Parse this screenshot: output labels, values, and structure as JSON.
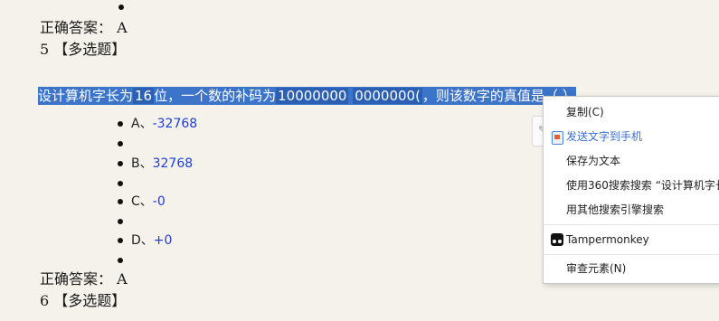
{
  "content": {
    "answer_label_1": "正确答案：  A",
    "q5_header": "5  【多选题】",
    "question": {
      "part1": "设计算机字长为",
      "word_size": "16",
      "part2": "位，一个数的补码为",
      "code1": "10000000",
      "code2": "0000000(",
      "part3": "，则该数字的真值是（   ）"
    },
    "options": [
      {
        "letter": "A、",
        "value": "-32768"
      },
      {
        "letter": "B、",
        "value": "32768"
      },
      {
        "letter": "C、",
        "value": "-0"
      },
      {
        "letter": "D、",
        "value": "+0"
      }
    ],
    "answer_label_2": "正确答案：  A",
    "q6_header": "6  【多选题】"
  },
  "context_menu": {
    "items": [
      {
        "label": "复制(C)"
      },
      {
        "label": "发送文字到手机",
        "color": "#3d6fd0",
        "icon": "send-to-phone-icon"
      },
      {
        "label": "保存为文本"
      },
      {
        "label": "使用360搜索搜索 “设计算机字长"
      },
      {
        "label": "用其他搜索引擎搜索"
      },
      {
        "label": "Tampermonkey",
        "icon": "tampermonkey-icon"
      },
      {
        "label": "审查元素(N)"
      }
    ]
  },
  "colors": {
    "page_background": "#f5f2eb",
    "selection": "#3b74c9",
    "option_value": "#1c3fd6"
  }
}
